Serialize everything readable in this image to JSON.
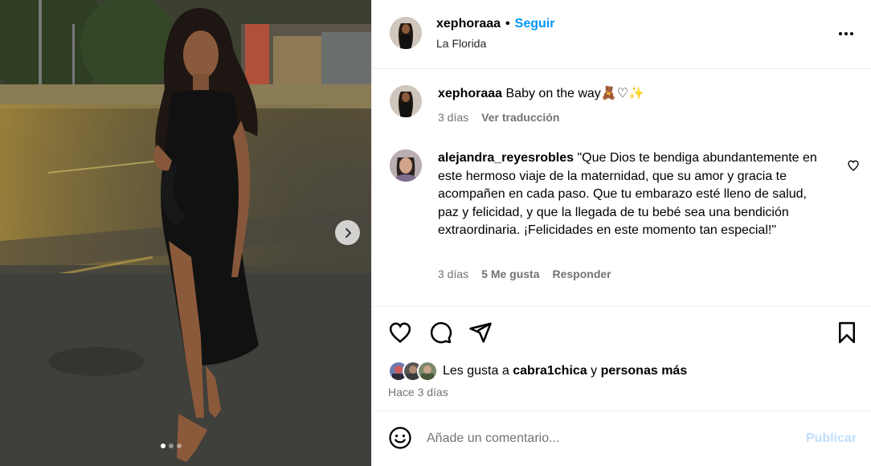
{
  "post": {
    "author": "xephoraaa",
    "separator": "•",
    "follow_label": "Seguir",
    "location": "La Florida"
  },
  "caption": {
    "author": "xephoraaa",
    "text": "Baby on the way🧸♡✨",
    "time": "3 días",
    "translate_label": "Ver traducción"
  },
  "comment": {
    "author": "alejandra_reyesrobles",
    "text": "\"Que Dios te bendiga abundantemente en este hermoso viaje de la maternidad, que su amor y gracia te acompañen en cada paso. Que tu embarazo esté lleno de salud, paz y felicidad, y que la llegada de tu bebé sea una bendición extraordinaria. ¡Felicidades en este momento tan especial!\"",
    "time": "3 días",
    "likes": "5 Me gusta",
    "reply_label": "Responder"
  },
  "likes": {
    "prefix": "Les gusta a",
    "user": "cabra1chica",
    "conj": "y",
    "others": "personas más"
  },
  "time_ago": "Hace 3 días",
  "composer": {
    "placeholder": "Añade un comentario...",
    "publish_label": "Publicar"
  },
  "carousel": {
    "slides": 3,
    "current": 1
  },
  "icons": [
    "more-options-icon",
    "heart-icon",
    "comment-icon",
    "share-icon",
    "bookmark-icon",
    "emoji-icon",
    "chevron-right-icon"
  ],
  "colors": {
    "accent": "#0095f6",
    "muted": "#737373",
    "publish_disabled": "#c0dffd",
    "border": "#efefef"
  }
}
